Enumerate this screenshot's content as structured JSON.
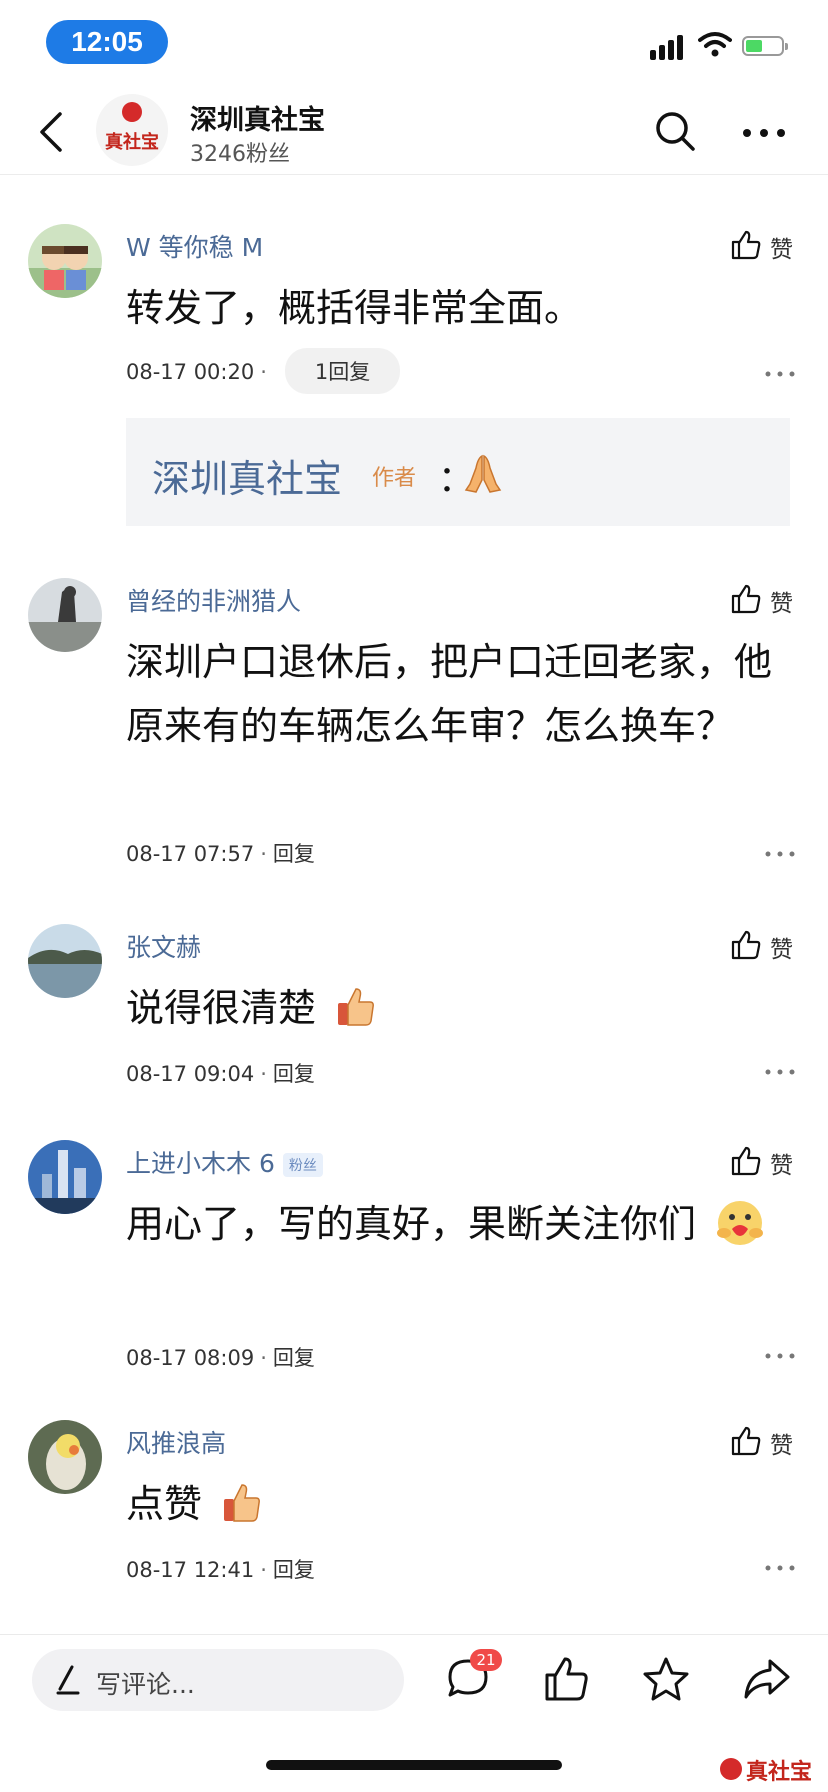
{
  "status_bar": {
    "time": "12:05"
  },
  "header": {
    "account_name": "深圳真社宝",
    "followers": "3246粉丝",
    "avatar_text": "真社宝"
  },
  "comments": [
    {
      "nickname": "W 等你稳 M",
      "text": "转发了，概括得非常全面。",
      "date": "08-17 00:20",
      "reply_label": "1回复",
      "like_label": "赞",
      "author_reply": {
        "name": "深圳真社宝",
        "tag": "作者",
        "colon": "："
      }
    },
    {
      "nickname": "曾经的非洲猎人",
      "text": "深圳户口退休后，把户口迁回老家，他原来有的车辆怎么年审？怎么换车？",
      "date": "08-17 07:57",
      "reply_label": "回复",
      "like_label": "赞"
    },
    {
      "nickname": "张文赫",
      "text": "说得很清楚",
      "date": "08-17 09:04",
      "reply_label": "回复",
      "like_label": "赞"
    },
    {
      "nickname": "上进小木木 6",
      "badge": "粉丝",
      "text": "用心了，写的真好，果断关注你们",
      "date": "08-17 08:09",
      "reply_label": "回复",
      "like_label": "赞"
    },
    {
      "nickname": "风推浪高",
      "text": "点赞",
      "date": "08-17 12:41",
      "reply_label": "回复",
      "like_label": "赞"
    }
  ],
  "bottom_bar": {
    "comment_placeholder": "写评论...",
    "comment_count": "21"
  },
  "watermark": {
    "text": "真社宝"
  },
  "colors": {
    "accent_blue": "#1e7be6",
    "nickname": "#4b6a96",
    "badge_red": "#f04a48",
    "brand_red": "#c3261c"
  }
}
